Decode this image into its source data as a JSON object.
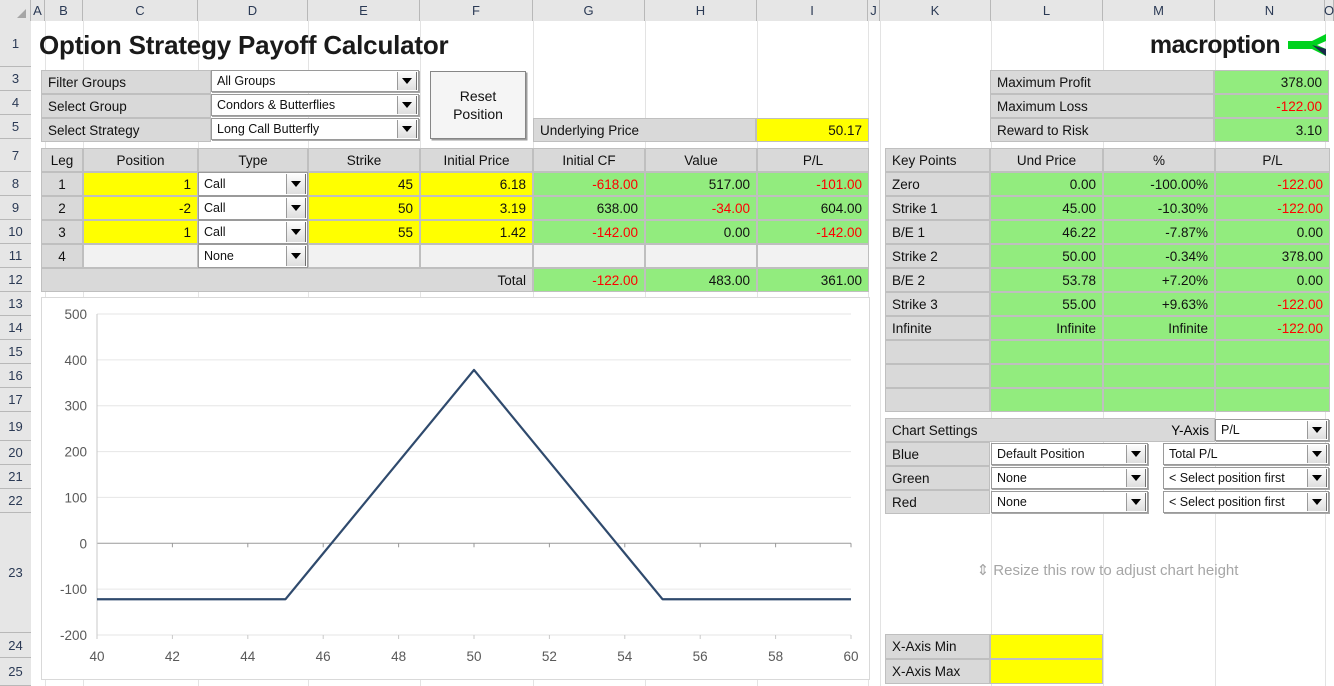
{
  "app": {
    "title": "Option Strategy Payoff Calculator",
    "brand": "macroption"
  },
  "grid": {
    "columns": [
      "A",
      "B",
      "C",
      "D",
      "E",
      "F",
      "G",
      "H",
      "I",
      "J",
      "K",
      "L",
      "M",
      "N",
      "O"
    ],
    "rows": [
      "1",
      "3",
      "4",
      "5",
      "7",
      "8",
      "9",
      "10",
      "11",
      "12",
      "13",
      "14",
      "15",
      "16",
      "17",
      "19",
      "20",
      "21",
      "22",
      "23",
      "24",
      "25"
    ]
  },
  "selectors": {
    "filter_groups_label": "Filter Groups",
    "filter_groups_value": "All Groups",
    "select_group_label": "Select Group",
    "select_group_value": "Condors & Butterflies",
    "select_strategy_label": "Select Strategy",
    "select_strategy_value": "Long Call Butterfly",
    "reset_button": "Reset\nPosition"
  },
  "underlying": {
    "label": "Underlying Price",
    "value": "50.17"
  },
  "summary": {
    "rows": [
      {
        "label": "Maximum Profit",
        "value": "378.00",
        "negative": false
      },
      {
        "label": "Maximum Loss",
        "value": "-122.00",
        "negative": true
      },
      {
        "label": "Reward to Risk",
        "value": "3.10",
        "negative": false
      }
    ]
  },
  "legs_table": {
    "headers": [
      "Leg",
      "Position",
      "Type",
      "Strike",
      "Initial Price",
      "Initial CF",
      "Value",
      "P/L"
    ],
    "rows": [
      {
        "leg": "1",
        "position": "1",
        "type": "Call",
        "strike": "45",
        "initial_price": "6.18",
        "initial_cf": "-618.00",
        "cf_neg": true,
        "value": "517.00",
        "value_neg": false,
        "pl": "-101.00",
        "pl_neg": true
      },
      {
        "leg": "2",
        "position": "-2",
        "type": "Call",
        "strike": "50",
        "initial_price": "3.19",
        "initial_cf": "638.00",
        "cf_neg": false,
        "value": "-34.00",
        "value_neg": true,
        "pl": "604.00",
        "pl_neg": false
      },
      {
        "leg": "3",
        "position": "1",
        "type": "Call",
        "strike": "55",
        "initial_price": "1.42",
        "initial_cf": "-142.00",
        "cf_neg": true,
        "value": "0.00",
        "value_neg": false,
        "pl": "-142.00",
        "pl_neg": true
      },
      {
        "leg": "4",
        "position": "",
        "type": "None",
        "strike": "",
        "initial_price": "",
        "initial_cf": "",
        "cf_neg": false,
        "value": "",
        "value_neg": false,
        "pl": "",
        "pl_neg": false
      }
    ],
    "total_label": "Total",
    "total_initial_cf": "-122.00",
    "total_cf_neg": true,
    "total_value": "483.00",
    "total_value_neg": false,
    "total_pl": "361.00",
    "total_pl_neg": false
  },
  "key_points": {
    "headers": [
      "Key Points",
      "Und Price",
      "%",
      "P/L"
    ],
    "rows": [
      {
        "name": "Zero",
        "und_price": "0.00",
        "pct": "-100.00%",
        "pl": "-122.00",
        "pl_neg": true
      },
      {
        "name": "Strike 1",
        "und_price": "45.00",
        "pct": "-10.30%",
        "pl": "-122.00",
        "pl_neg": true
      },
      {
        "name": "B/E 1",
        "und_price": "46.22",
        "pct": "-7.87%",
        "pl": "0.00",
        "pl_neg": false
      },
      {
        "name": "Strike 2",
        "und_price": "50.00",
        "pct": "-0.34%",
        "pl": "378.00",
        "pl_neg": false
      },
      {
        "name": "B/E 2",
        "und_price": "53.78",
        "pct": "+7.20%",
        "pl": "0.00",
        "pl_neg": false
      },
      {
        "name": "Strike 3",
        "und_price": "55.00",
        "pct": "+9.63%",
        "pl": "-122.00",
        "pl_neg": true
      },
      {
        "name": "Infinite",
        "und_price": "Infinite",
        "pct": "Infinite",
        "pl": "-122.00",
        "pl_neg": true
      },
      {
        "name": "",
        "und_price": "",
        "pct": "",
        "pl": "",
        "pl_neg": false
      },
      {
        "name": "",
        "und_price": "",
        "pct": "",
        "pl": "",
        "pl_neg": false
      },
      {
        "name": "",
        "und_price": "",
        "pct": "",
        "pl": "",
        "pl_neg": false
      }
    ]
  },
  "chart_settings": {
    "title": "Chart Settings",
    "yaxis_label": "Y-Axis",
    "yaxis_value": "P/L",
    "series": [
      {
        "color_label": "Blue",
        "position": "Default Position",
        "metric": "Total P/L"
      },
      {
        "color_label": "Green",
        "position": "None",
        "metric": "< Select position first"
      },
      {
        "color_label": "Red",
        "position": "None",
        "metric": "< Select position first"
      }
    ]
  },
  "resize_hint": "⇕ Resize this row to adjust chart height",
  "axis_inputs": {
    "xmin_label": "X-Axis Min",
    "xmin_value": "",
    "xmax_label": "X-Axis Max",
    "xmax_value": ""
  },
  "chart_data": {
    "type": "line",
    "title": "",
    "xlabel": "",
    "ylabel": "",
    "xlim": [
      40,
      60
    ],
    "ylim": [
      -200,
      500
    ],
    "xticks": [
      40,
      42,
      44,
      46,
      48,
      50,
      52,
      54,
      56,
      58,
      60
    ],
    "yticks": [
      -200,
      -100,
      0,
      100,
      200,
      300,
      400,
      500
    ],
    "grid": true,
    "legend": "none",
    "line_color": "#2f4a6d",
    "series": [
      {
        "name": "Total P/L",
        "x": [
          40,
          41,
          42,
          43,
          44,
          45,
          46,
          46.22,
          47,
          48,
          49,
          50,
          51,
          52,
          53,
          53.78,
          54,
          55,
          56,
          57,
          58,
          59,
          60
        ],
        "y": [
          -122,
          -122,
          -122,
          -122,
          -122,
          -122,
          -22,
          0,
          78,
          178,
          278,
          378,
          278,
          178,
          78,
          0,
          -22,
          -122,
          -122,
          -122,
          -122,
          -122,
          -122
        ]
      }
    ]
  }
}
